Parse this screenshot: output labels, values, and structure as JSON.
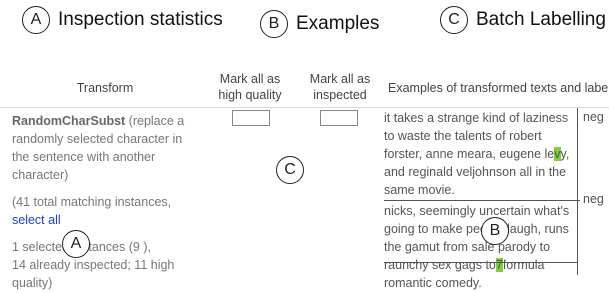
{
  "annotations": {
    "a": {
      "letter": "A",
      "text": "Inspection statistics"
    },
    "b": {
      "letter": "B",
      "text": "Examples"
    },
    "c": {
      "letter": "C",
      "text": "Batch Labelling"
    }
  },
  "table": {
    "headers": {
      "transform": "Transform",
      "mark_high_quality": "Mark all as high quality",
      "mark_inspected": "Mark all as inspected",
      "examples": "Examples of transformed texts and labels"
    },
    "row": {
      "transform_name": "RandomCharSubst",
      "description": " (replace a randomly selected character in the sentence with another character)",
      "matching_prefix": "(41 total matching instances, ",
      "select_all": "select all",
      "selected": "1 selected instances (9 ),",
      "inspected": "14 already inspected; 11 high quality)"
    },
    "examples": [
      {
        "text_before": "it takes a strange kind of laziness to waste the talents of robert forster, anne meara, eugene le",
        "highlight": "v",
        "text_after": "y, and reginald veljohnson all in the same movie.",
        "label": "neg"
      },
      {
        "text_before": "nicks, seemingly uncertain what's going to make people laugh, runs the gamut from sale parody to raunchy sex gags to",
        "highlight": "7",
        "text_after": "formula romantic comedy.",
        "label": "neg"
      }
    ]
  },
  "overlay_letters": {
    "a": "A",
    "b": "B",
    "c": "C"
  },
  "colors": {
    "highlight": "#7fcf3a",
    "link": "#1a3fd1"
  }
}
